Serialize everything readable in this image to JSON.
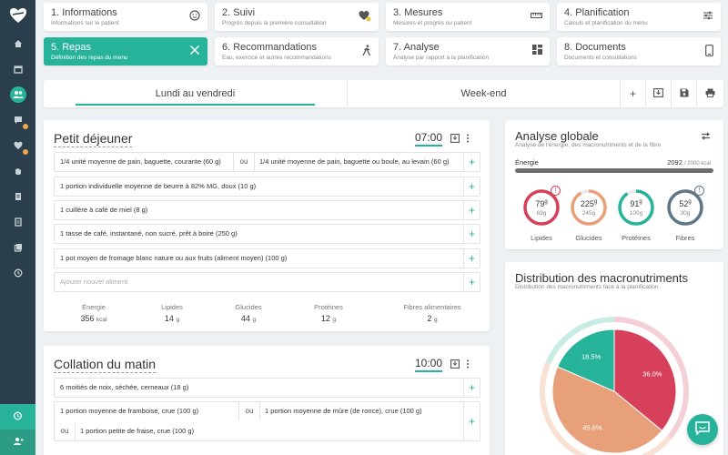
{
  "colors": {
    "accent": "#27b399",
    "sidebar": "#2a3e4c",
    "lipides": "#d6405a",
    "glucides": "#e8a07a",
    "proteines": "#27b399",
    "fibres": "#5f7687"
  },
  "sidebar": {
    "icons": [
      "home-icon",
      "calendar-icon",
      "users-icon",
      "chat-icon",
      "heart-icon",
      "hand-icon",
      "clipboard-icon",
      "document-icon",
      "book-icon",
      "history-icon"
    ],
    "bottom_icons": [
      "alarm-icon",
      "user-add-icon"
    ]
  },
  "steps": [
    {
      "title": "1. Informations",
      "subtitle": "Informations sur le patient",
      "icon": "face-icon"
    },
    {
      "title": "2. Suivi",
      "subtitle": "Progrès depuis la première consultation",
      "icon": "heart-icon"
    },
    {
      "title": "3. Mesures",
      "subtitle": "Mesures et progrès ou patient",
      "icon": "ruler-icon"
    },
    {
      "title": "4. Planification",
      "subtitle": "Calculs et planification du menu",
      "icon": "sliders-icon"
    },
    {
      "title": "5. Repas",
      "subtitle": "Définition des repas du menu",
      "icon": "utensils-icon"
    },
    {
      "title": "6. Recommandations",
      "subtitle": "Eau, exercice et autres recommandations",
      "icon": "walk-icon"
    },
    {
      "title": "7. Analyse",
      "subtitle": "Analyse par rapport à la planification",
      "icon": "grid-icon"
    },
    {
      "title": "8. Documents",
      "subtitle": "Documents et consultations",
      "icon": "phone-icon"
    }
  ],
  "tabs": {
    "weekdays": "Lundi au vendredi",
    "weekend": "Week-end",
    "add": "+"
  },
  "meals": {
    "breakfast": {
      "title": "Petit déjeuner",
      "time": "07:00",
      "row1_a": "1/4 unité moyenne de pain, baguette, courante (60 g)",
      "row1_or": "ou",
      "row1_b": "1/4 unité moyenne de pain, baguette ou boule, au levain (60 g)",
      "row2": "1 portion individuelle moyenne de beurre à 82% MG, doux (10 g)",
      "row3": "1 cuillère à café de miel (8 g)",
      "row4": "1 tasse de café, instantané, non sucré, prêt à boire (250 g)",
      "row5": "1 pot moyen de fromage blanc nature ou aux fruits (aliment moyen) (100 g)",
      "add_placeholder": "Ajouter nouvel aliment",
      "totals": [
        {
          "label": "Énergie",
          "value": "356",
          "unit": "kcal"
        },
        {
          "label": "Lipides",
          "value": "14",
          "unit": "g"
        },
        {
          "label": "Glucides",
          "value": "44",
          "unit": "g"
        },
        {
          "label": "Protéines",
          "value": "12",
          "unit": "g"
        },
        {
          "label": "Fibres alimentaires",
          "value": "2",
          "unit": "g"
        }
      ]
    },
    "snack": {
      "title": "Collation du matin",
      "time": "10:00",
      "row1": "6 moitiés de noix, séchée, cerneaux (18 g)",
      "row2_a": "1 portion moyenne de framboise, crue (100 g)",
      "row2_or": "ou",
      "row2_b": "1 portion moyenne de mûre (de ronce), crue (100 g)",
      "row2_or2": "ou",
      "row2_c": "1 portion petite de fraise, crue (100 g)"
    }
  },
  "analysis": {
    "title": "Analyse globale",
    "subtitle": "Analyse de l'énergie, des macronutriments et de la fibre",
    "energy_label": "Énergie",
    "energy_value": "2092",
    "energy_target": "/ 2000 kcal",
    "energy_ratio": 1.0,
    "gauges": [
      {
        "label": "Lipides",
        "value": "79",
        "unit": "g",
        "target": "69g",
        "ratio": 1.0,
        "alert": "!"
      },
      {
        "label": "Glucides",
        "value": "225",
        "unit": "g",
        "target": "245g",
        "ratio": 0.92,
        "alert": ""
      },
      {
        "label": "Protéines",
        "value": "91",
        "unit": "g",
        "target": "100g",
        "ratio": 0.91,
        "alert": ""
      },
      {
        "label": "Fibres",
        "value": "52",
        "unit": "g",
        "target": "30g",
        "ratio": 1.0,
        "alert": "!"
      }
    ]
  },
  "distribution": {
    "title": "Distribution des macronutriments",
    "subtitle": "Distribution des macronutriments face à la planification"
  },
  "chart_data": {
    "type": "pie",
    "categories": [
      "Lipides",
      "Glucides",
      "Protéines"
    ],
    "values": [
      36.0,
      45.6,
      18.5
    ],
    "labels": [
      "36.0%",
      "45.6%",
      "18.5%"
    ],
    "colors": [
      "#d6405a",
      "#e8a07a",
      "#27b399"
    ]
  }
}
